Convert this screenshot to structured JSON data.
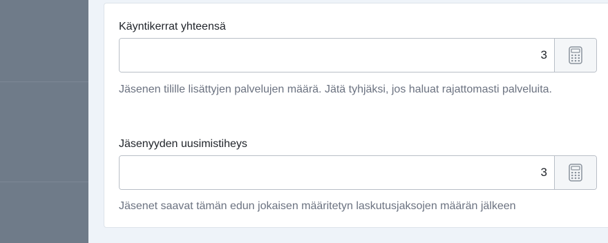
{
  "fields": [
    {
      "label": "Käyntikerrat yhteensä",
      "value": "3",
      "help": "Jäsenen tilille lisättyjen palvelujen määrä. Jätä tyhjäksi, jos haluat rajattomasti palveluita.",
      "addon_icon": "calculator-icon"
    },
    {
      "label": "Jäsenyyden uusimistiheys",
      "value": "3",
      "help": "Jäsenet saavat tämän edun jokaisen määritetyn laskutusjaksojen määrän jälkeen",
      "addon_icon": "calculator-icon"
    }
  ],
  "colors": {
    "sidebar": "#6f7b89",
    "page_background": "#eef3f9",
    "card_background": "#ffffff",
    "help_text": "#6b7280"
  }
}
